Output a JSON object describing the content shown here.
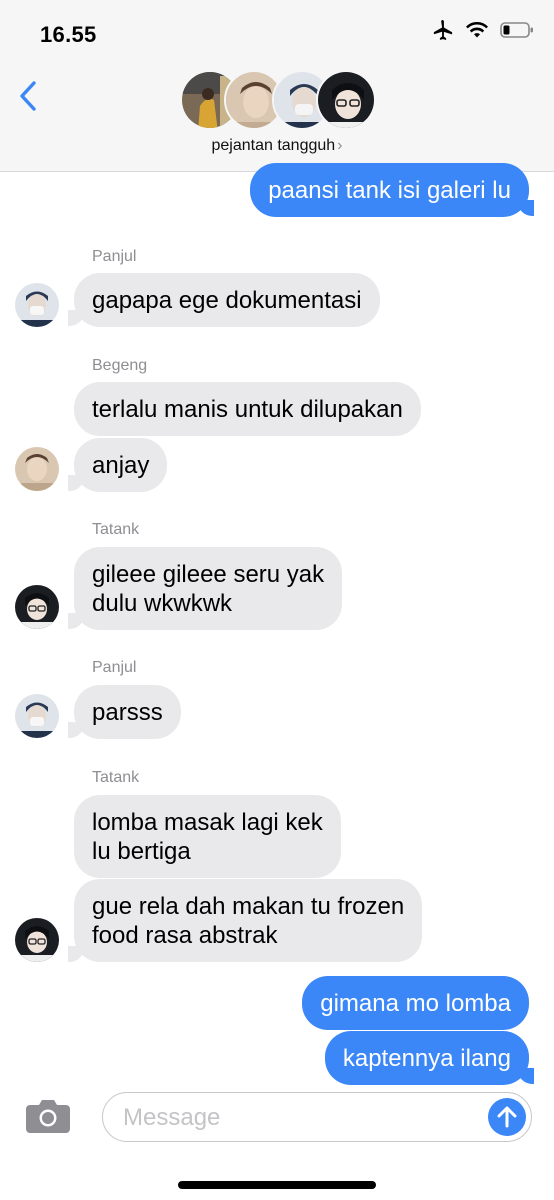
{
  "status_bar": {
    "time": "16.55",
    "icons": [
      "airplane-icon",
      "wifi-icon",
      "battery-icon"
    ]
  },
  "header": {
    "group_name": "pejantan tangguh",
    "chevron": "›",
    "participants": [
      "member-1-avatar",
      "member-2-avatar",
      "member-3-avatar",
      "member-4-avatar"
    ]
  },
  "messages": [
    {
      "from": "me",
      "text": "paansi tank isi galeri lu"
    },
    {
      "sender": "Panjul",
      "text": "gapapa ege dokumentasi"
    },
    {
      "sender": "Begeng",
      "text": "terlalu manis untuk dilupakan"
    },
    {
      "sender": "Begeng",
      "text": "anjay"
    },
    {
      "sender": "Tatank",
      "lines": [
        "gileee gileee seru yak",
        "dulu wkwkwk"
      ]
    },
    {
      "sender": "Panjul",
      "text": "parsss"
    },
    {
      "sender": "Tatank",
      "lines": [
        "lomba masak lagi kek",
        "lu bertiga"
      ]
    },
    {
      "sender": "Tatank",
      "lines": [
        "gue rela dah makan tu frozen",
        "food rasa abstrak"
      ]
    },
    {
      "from": "me",
      "text": "gimana mo lomba"
    },
    {
      "from": "me",
      "text": "kaptennya ilang"
    }
  ],
  "senders": {
    "panjul_1": "Panjul",
    "begeng": "Begeng",
    "tatank_1": "Tatank",
    "panjul_2": "Panjul",
    "tatank_2": "Tatank"
  },
  "composer": {
    "placeholder": "Message",
    "camera_icon": "camera-icon",
    "send_icon": "arrow-up-icon"
  },
  "colors": {
    "outgoing_bubble": "#3b87f7",
    "incoming_bubble": "#e9e9eb",
    "accent": "#3b87f7"
  }
}
